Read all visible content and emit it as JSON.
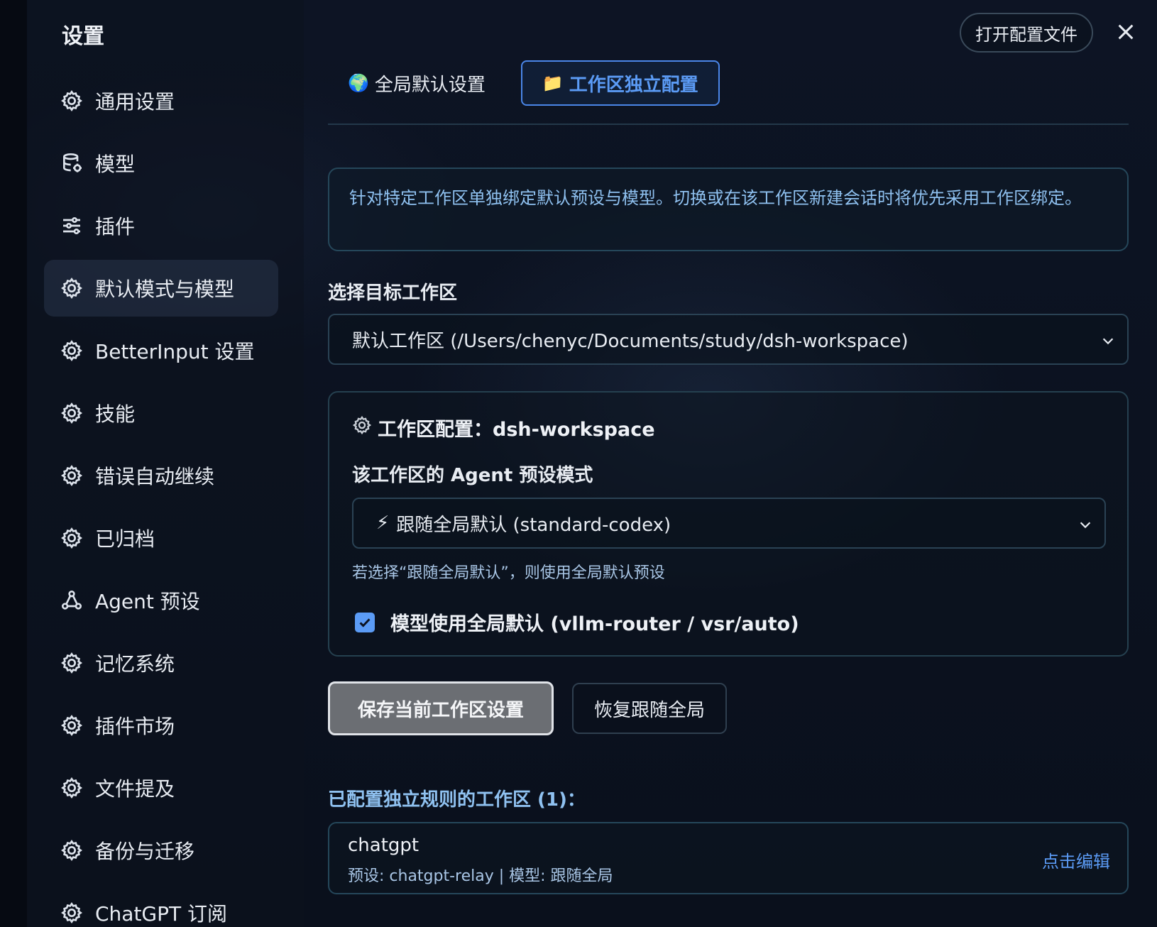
{
  "header": {
    "title": "设置",
    "open_config_label": "打开配置文件"
  },
  "sidebar": {
    "items": [
      {
        "label": "通用设置",
        "icon": "gear-icon"
      },
      {
        "label": "模型",
        "icon": "database-icon"
      },
      {
        "label": "插件",
        "icon": "sliders-icon"
      },
      {
        "label": "默认模式与模型",
        "icon": "gear-icon",
        "active": true
      },
      {
        "label": "BetterInput 设置",
        "icon": "gear-icon"
      },
      {
        "label": "技能",
        "icon": "gear-icon"
      },
      {
        "label": "错误自动继续",
        "icon": "gear-icon"
      },
      {
        "label": "已归档",
        "icon": "gear-icon"
      },
      {
        "label": "Agent 预设",
        "icon": "nodes-icon"
      },
      {
        "label": "记忆系统",
        "icon": "gear-icon"
      },
      {
        "label": "插件市场",
        "icon": "gear-icon"
      },
      {
        "label": "文件提及",
        "icon": "gear-icon"
      },
      {
        "label": "备份与迁移",
        "icon": "gear-icon"
      },
      {
        "label": "ChatGPT 订阅",
        "icon": "gear-icon"
      }
    ]
  },
  "tabs": [
    {
      "emoji": "🌍",
      "label": "全局默认设置"
    },
    {
      "emoji": "📁",
      "label": "工作区独立配置",
      "active": true
    }
  ],
  "main": {
    "info_text": "针对特定工作区单独绑定默认预设与模型。切换或在该工作区新建会话时将优先采用工作区绑定。",
    "target_label": "选择目标工作区",
    "target_value": "默认工作区 (/Users/chenyc/Documents/study/dsh-workspace)",
    "card": {
      "title": "工作区配置：dsh-workspace",
      "preset_label": "该工作区的 Agent 预设模式",
      "preset_emoji": "⚡",
      "preset_value": "跟随全局默认 (standard-codex)",
      "preset_hint": "若选择“跟随全局默认”，则使用全局默认预设",
      "checkbox_label": "模型使用全局默认 (vllm-router / vsr/auto)",
      "checkbox_checked": true
    },
    "save_label": "保存当前工作区设置",
    "reset_label": "恢复跟随全局",
    "list_title": "已配置独立规则的工作区 (1)：",
    "list": [
      {
        "name": "chatgpt",
        "meta": "预设: chatgpt-relay | 模型: 跟随全局",
        "edit_label": "点击编辑"
      }
    ]
  },
  "colors": {
    "accent": "#5b9bf5",
    "background": "#0b1120",
    "info_text": "#8fc1f0"
  }
}
